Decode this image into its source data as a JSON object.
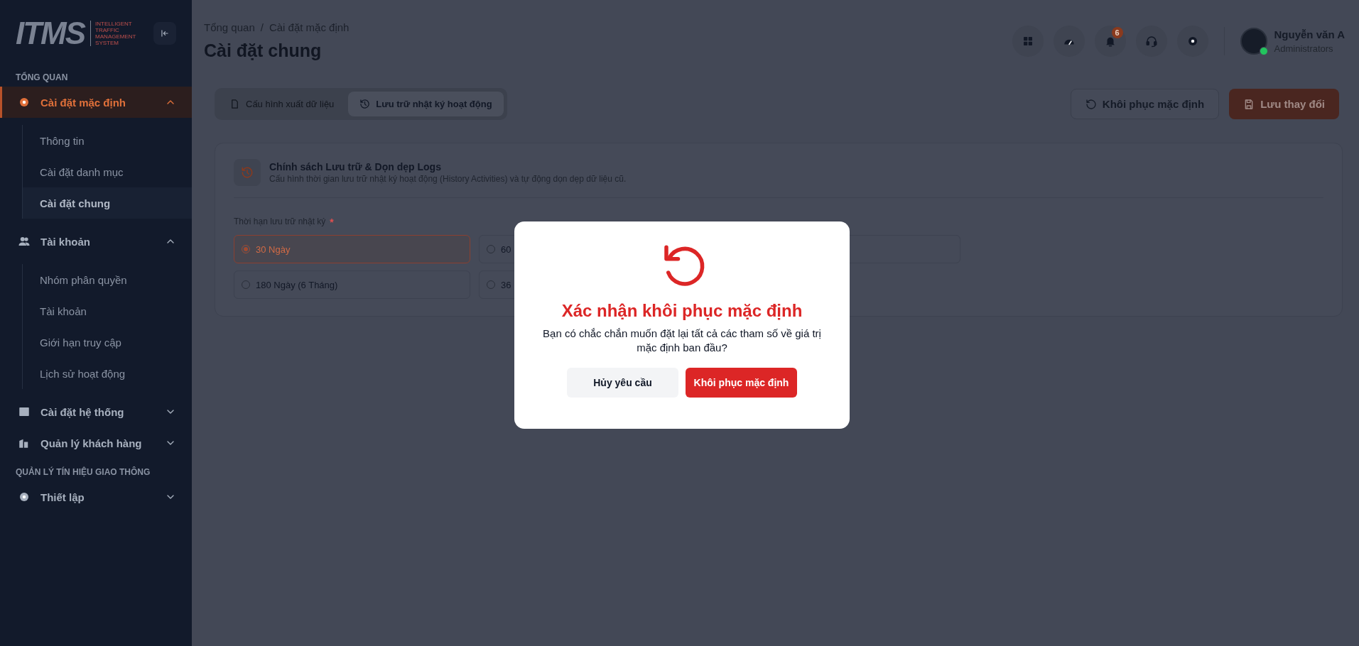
{
  "logo": {
    "mark": "ITMS",
    "tagline": [
      "INTELLIGENT",
      "TRAFFIC",
      "MANAGEMENT",
      "SYSTEM"
    ]
  },
  "sidebar": {
    "items": [
      {
        "kind": "section",
        "label": "TỔNG QUAN"
      },
      {
        "kind": "group",
        "label": "Cài đặt mặc định",
        "selected": true,
        "expanded": true,
        "children": [
          {
            "label": "Thông tin",
            "selected": false
          },
          {
            "label": "Cài đặt danh mục",
            "selected": false
          },
          {
            "label": "Cài đặt chung",
            "selected": true
          }
        ]
      },
      {
        "kind": "group",
        "label": "Tài khoản",
        "selected": false,
        "expanded": true,
        "children": [
          {
            "label": "Nhóm phân quyền",
            "selected": false
          },
          {
            "label": "Tài khoản",
            "selected": false
          },
          {
            "label": "Giới hạn truy cập",
            "selected": false
          },
          {
            "label": "Lịch sử hoạt động",
            "selected": false
          }
        ]
      },
      {
        "kind": "group",
        "label": "Cài đặt hệ thống",
        "selected": false,
        "expanded": false
      },
      {
        "kind": "group",
        "label": "Quản lý khách hàng",
        "selected": false,
        "expanded": false
      },
      {
        "kind": "section",
        "label": "QUẢN LÝ TÍN HIỆU GIAO THÔNG"
      },
      {
        "kind": "group",
        "label": "Thiết lập",
        "selected": false,
        "expanded": false
      }
    ]
  },
  "header": {
    "breadcrumb": [
      "Tổng quan",
      "Cài đặt mặc định"
    ],
    "separator": "/",
    "title": "Cài đặt chung",
    "notification_count": "6",
    "user": {
      "name": "Nguyễn văn A",
      "role": "Administrators",
      "online": true
    }
  },
  "tabs": [
    {
      "label": "Cấu hình xuất dữ liệu",
      "selected": false
    },
    {
      "label": "Lưu trữ nhật ký hoạt động",
      "selected": true
    }
  ],
  "actions": {
    "reset": "Khôi phục mặc định",
    "save": "Lưu thay đổi"
  },
  "card": {
    "title": "Chính sách Lưu trữ & Dọn dẹp Logs",
    "subtitle": "Cấu hình thời gian lưu trữ nhật ký hoạt động (History Activities) và tự động dọn dẹp dữ liệu cũ.",
    "field_label": "Thời hạn lưu trữ nhật ký",
    "required_mark": "*",
    "options": [
      {
        "kind": "radio",
        "label": "30 Ngày",
        "selected": true
      },
      {
        "kind": "radio",
        "label": "60",
        "selected": false
      },
      {
        "kind": "covered"
      },
      {
        "kind": "radio",
        "label": "180 Ngày (6 Tháng)",
        "selected": false
      },
      {
        "kind": "radio",
        "label": "36",
        "selected": false
      }
    ]
  },
  "dialog": {
    "title": "Xác nhận khôi phục mặc định",
    "message": "Bạn có chắc chắn muốn đặt lại tất cả các tham số về giá trị mặc định ban đầu?",
    "cancel": "Hủy yêu cầu",
    "confirm": "Khôi phục mặc định"
  }
}
